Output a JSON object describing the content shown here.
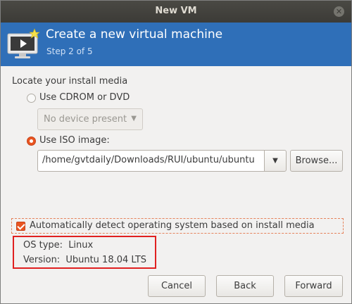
{
  "window": {
    "title": "New VM"
  },
  "header": {
    "title": "Create a new virtual machine",
    "step": "Step 2 of 5"
  },
  "media": {
    "section_title": "Locate your install media",
    "cdrom": {
      "label": "Use CDROM or DVD",
      "selected": false,
      "device_value": "No device present"
    },
    "iso": {
      "label": "Use ISO image:",
      "selected": true,
      "path_value": "/home/gvtdaily/Downloads/RUI/ubuntu/ubuntu",
      "browse_label": "Browse..."
    }
  },
  "detect": {
    "label": "Automatically detect operating system based on install media",
    "checked": true
  },
  "os_info": {
    "type_label": "OS type:",
    "type_value": "Linux",
    "version_label": "Version:",
    "version_value": "Ubuntu 18.04 LTS"
  },
  "buttons": {
    "cancel": "Cancel",
    "back": "Back",
    "forward": "Forward"
  },
  "colors": {
    "header_bg": "#2f6fb8",
    "accent": "#e95420",
    "highlight_box": "#e02020",
    "titlebar": "#3c3b37"
  },
  "icons": {
    "close": "close-icon",
    "header": "virtual-machine-icon",
    "dropdown": "chevron-down-icon"
  }
}
